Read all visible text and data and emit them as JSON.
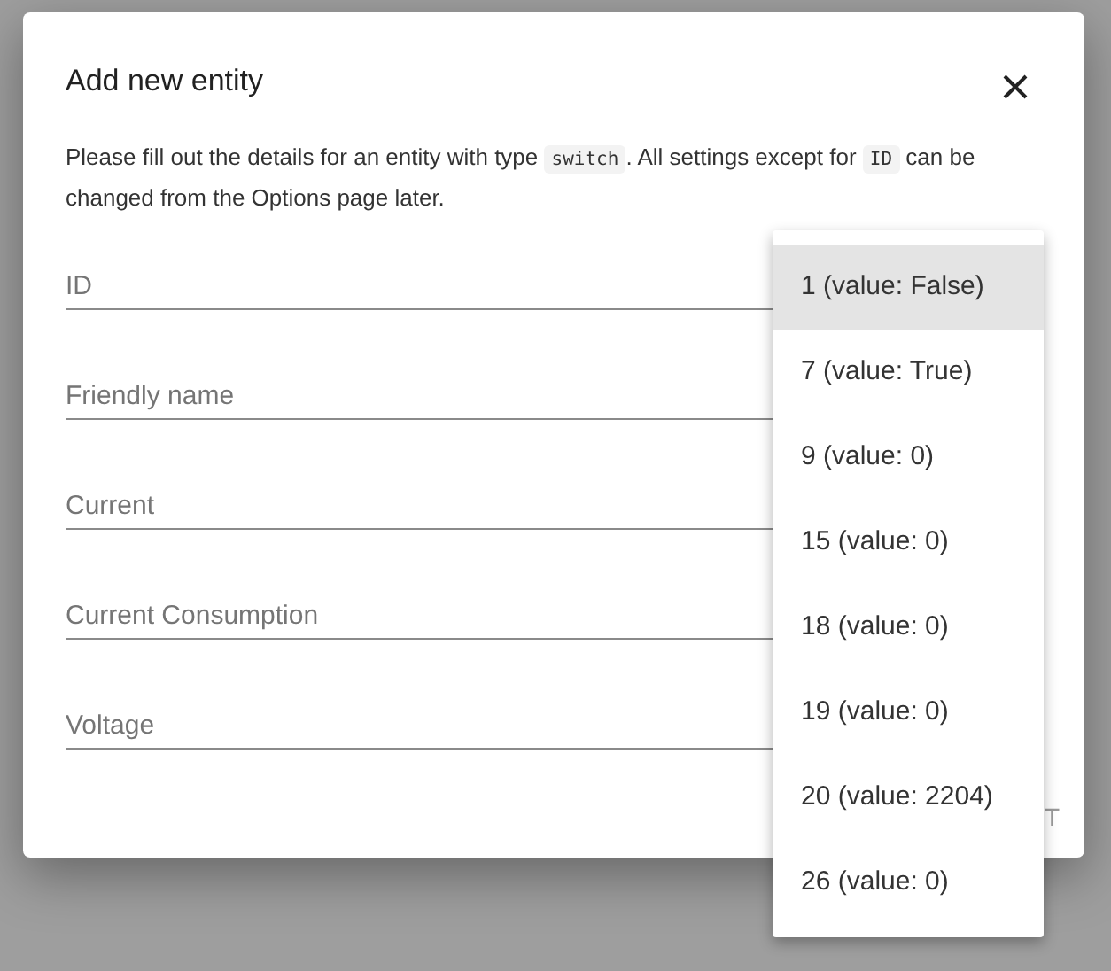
{
  "dialog": {
    "title": "Add new entity",
    "description": [
      {
        "kind": "text",
        "text": "Please fill out the details for an entity with type "
      },
      {
        "kind": "code",
        "text": "switch"
      },
      {
        "kind": "text",
        "text": ". All settings except for "
      },
      {
        "kind": "code",
        "text": "ID"
      },
      {
        "kind": "text",
        "text": " can be changed from the Options page later."
      }
    ],
    "fields": [
      {
        "placeholder": "ID"
      },
      {
        "placeholder": "Friendly name"
      },
      {
        "placeholder": "Current"
      },
      {
        "placeholder": "Current Consumption"
      },
      {
        "placeholder": "Voltage"
      }
    ],
    "action_button": {
      "label": "T",
      "disabled": true
    }
  },
  "dropdown_menu": [
    {
      "label": "1 (value: False)",
      "selected": true
    },
    {
      "label": "7 (value: True)",
      "selected": false
    },
    {
      "label": "9 (value: 0)",
      "selected": false
    },
    {
      "label": "15 (value: 0)",
      "selected": false
    },
    {
      "label": "18 (value: 0)",
      "selected": false
    },
    {
      "label": "19 (value: 0)",
      "selected": false
    },
    {
      "label": "20 (value: 2204)",
      "selected": false
    },
    {
      "label": "26 (value: 0)",
      "selected": false
    }
  ]
}
